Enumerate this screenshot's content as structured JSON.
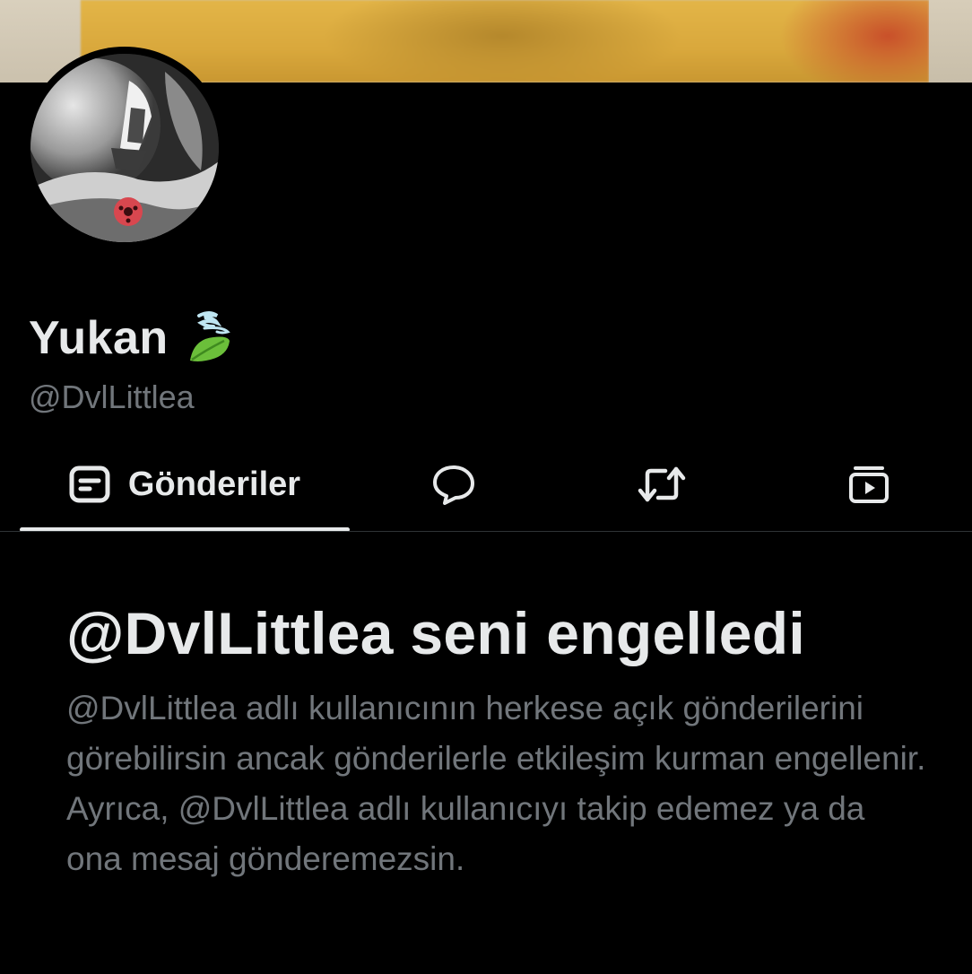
{
  "banner": {
    "colors": {
      "left": "#d3cab6",
      "main": "#dfb043",
      "accent": "#c9502a"
    }
  },
  "profile": {
    "display_name": "Yukan",
    "name_emoji": "leaf-fluttering-in-wind-emoji",
    "handle": "@DvlLittlea",
    "avatar_icon": "avatar-image"
  },
  "tabs": [
    {
      "label": "Gönderiler",
      "icon": "posts-icon",
      "active": true
    },
    {
      "label": "",
      "icon": "replies-icon",
      "active": false
    },
    {
      "label": "",
      "icon": "reposts-icon",
      "active": false
    },
    {
      "label": "",
      "icon": "media-icon",
      "active": false
    }
  ],
  "blocked": {
    "title": "@DvlLittlea seni engelledi",
    "description": "@DvlLittlea adlı kullanıcının herkese açık gönderilerini görebilirsin ancak gönderilerle etkileşim kurman engellenir. Ayrıca, @DvlLittlea adlı kullanıcıyı takip edemez ya da ona mesaj gönderemezsin."
  },
  "colors": {
    "background": "#000000",
    "primary_text": "#e7e9ea",
    "secondary_text": "#71767b",
    "divider": "#2f3336"
  }
}
